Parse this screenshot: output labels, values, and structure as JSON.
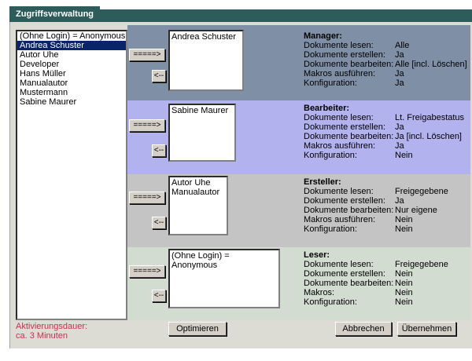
{
  "window": {
    "title": "Zugriffsverwaltung"
  },
  "users": [
    "(Ohne Login) = Anonymous",
    "Andrea Schuster",
    "Autor Uhe",
    "Developer",
    "Hans Müller",
    "Manualautor",
    "Mustermann",
    "Sabine Maurer"
  ],
  "selected_user": "Andrea Schuster",
  "buttons": {
    "assign": "=====>",
    "remove": "<--",
    "optimize": "Optimieren",
    "cancel": "Abbrechen",
    "apply": "Übernehmen"
  },
  "keys": {
    "read": "Dokumente lesen:",
    "create": "Dokumente erstellen:",
    "edit": "Dokumente bearbeiten:",
    "macros_exec": "Makros ausführen:",
    "macros": "Makros:",
    "config": "Konfiguration:"
  },
  "roles": {
    "manager": {
      "title": "Manager:",
      "members": [
        "Andrea Schuster"
      ],
      "read": "Alle",
      "create": "Ja",
      "edit": "Alle [incl. Löschen]",
      "macros": "Ja",
      "config": "Ja"
    },
    "bearbeiter": {
      "title": "Bearbeiter:",
      "members": [
        "Sabine Maurer"
      ],
      "read": "Lt. Freigabestatus",
      "create": "Ja",
      "edit": "Ja [incl. Löschen]",
      "macros": "Ja",
      "config": "Nein"
    },
    "ersteller": {
      "title": "Ersteller:",
      "members": [
        "Autor Uhe",
        "Manualautor"
      ],
      "read": "Freigegebene",
      "create": "Ja",
      "edit": "Nur eigene",
      "macros": "Nein",
      "config": "Nein"
    },
    "leser": {
      "title": "Leser:",
      "members": [
        "(Ohne Login) = Anonymous"
      ],
      "read": "Freigegebene",
      "create": "Nein",
      "edit": "Nein",
      "macros": "Nein",
      "config": "Nein"
    }
  },
  "footer": {
    "activation_label": "Aktivierungsdauer:",
    "activation_value": "ca. 3 Minuten"
  }
}
